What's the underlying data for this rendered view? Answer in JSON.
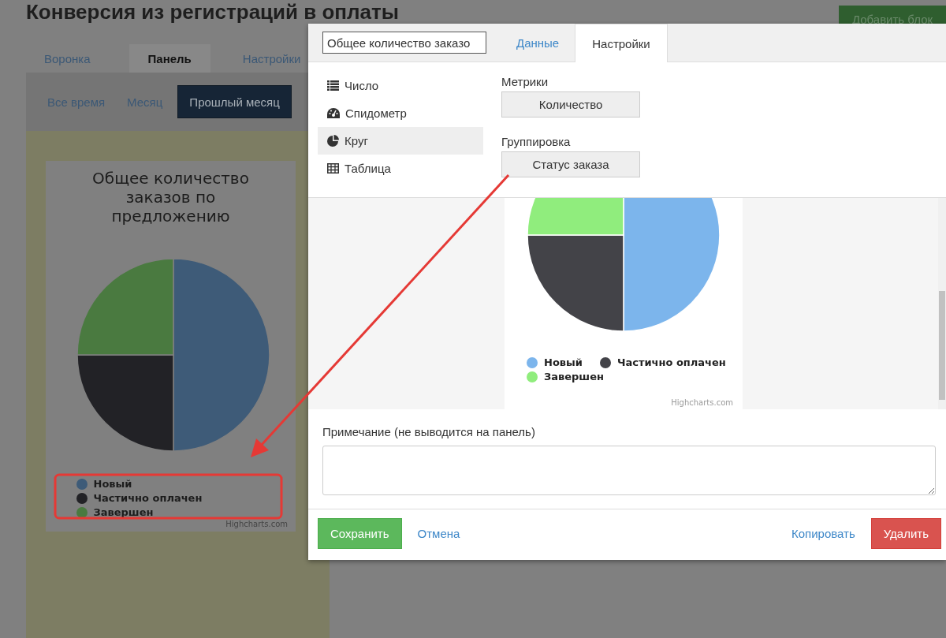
{
  "page": {
    "title": "Конверсия из регистраций в оплаты",
    "add_block_button": "Добавить блок",
    "tabs": [
      {
        "label": "Воронка",
        "selected": false
      },
      {
        "label": "Панель",
        "selected": true
      },
      {
        "label": "Настройки",
        "selected": false
      }
    ],
    "period_tabs": [
      {
        "label": "Все время",
        "selected": false
      },
      {
        "label": "Месяц",
        "selected": false
      },
      {
        "label": "Прошлый месяц",
        "selected": true
      }
    ],
    "chart_card": {
      "title": "Общее количество заказов по предложению",
      "legend": [
        {
          "name": "Новый",
          "color": "#3e5b78"
        },
        {
          "name": "Частично оплачен",
          "color": "#222226"
        },
        {
          "name": "Завершен",
          "color": "#4a7a40"
        }
      ],
      "credit": "Highcharts.com"
    }
  },
  "modal": {
    "name_field": {
      "value": "Общее количество заказо"
    },
    "tabs": [
      {
        "label": "Данные",
        "selected": false
      },
      {
        "label": "Настройки",
        "selected": true
      }
    ],
    "chart_types": [
      {
        "label": "Число",
        "kind": "list",
        "selected": false
      },
      {
        "label": "Спидометр",
        "kind": "gauge",
        "selected": false
      },
      {
        "label": "Круг",
        "kind": "pie",
        "selected": true
      },
      {
        "label": "Таблица",
        "kind": "table",
        "selected": false
      }
    ],
    "metrics": {
      "label": "Метрики",
      "value": "Количество"
    },
    "grouping": {
      "label": "Группировка",
      "value": "Статус заказа"
    },
    "preview": {
      "legend": [
        {
          "name": "Новый",
          "color": "#7cb5ec"
        },
        {
          "name": "Частично оплачен",
          "color": "#434348"
        },
        {
          "name": "Завершен",
          "color": "#90ed7d"
        }
      ],
      "credit": "Highcharts.com"
    },
    "note": {
      "label": "Примечание (не выводится на панель)"
    },
    "buttons": [
      {
        "label": "Сохранить",
        "kind": "primary"
      },
      {
        "label": "Отмена",
        "kind": "link"
      },
      {
        "label": "Копировать",
        "kind": "link"
      },
      {
        "label": "Удалить",
        "kind": "danger"
      }
    ]
  }
}
